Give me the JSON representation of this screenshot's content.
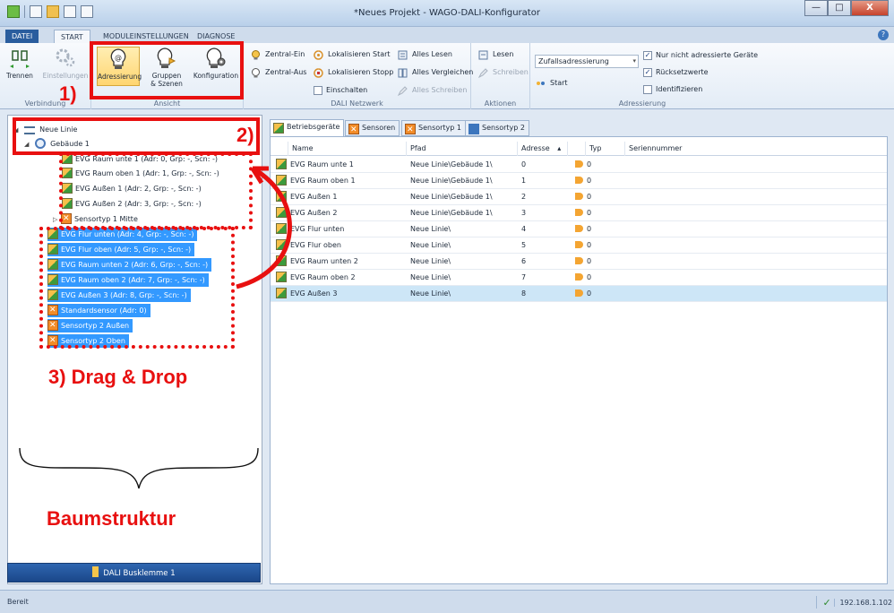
{
  "window": {
    "title": "*Neues Projekt - WAGO-DALI-Konfigurator",
    "minimize": "—",
    "maximize": "□",
    "close": "X"
  },
  "ribbon_tabs": [
    {
      "label": "DATEI",
      "active": false
    },
    {
      "label": "START",
      "active": true
    },
    {
      "label": "MODULEINSTELLUNGEN",
      "active": false
    },
    {
      "label": "DIAGNOSE",
      "active": false
    }
  ],
  "help": "?",
  "ribbon": {
    "verbindung": {
      "label": "Verbindung",
      "trennen": "Trennen",
      "einstellungen": "Einstellungen"
    },
    "ansicht": {
      "label": "Ansicht",
      "adressierung": "Adressierung",
      "gruppen_szenen_1": "Gruppen",
      "gruppen_szenen_2": "& Szenen",
      "konfiguration": "Konfiguration"
    },
    "dali_netzwerk": {
      "label": "DALI Netzwerk",
      "zentral_ein": "Zentral-Ein",
      "zentral_aus": "Zentral-Aus",
      "lokalisieren_start": "Lokalisieren Start",
      "lokalisieren_stopp": "Lokalisieren Stopp",
      "einschalten": "Einschalten",
      "alles_lesen": "Alles Lesen",
      "alles_vergleichen": "Alles Vergleichen",
      "alles_schreiben": "Alles Schreiben"
    },
    "aktionen": {
      "label": "Aktionen",
      "lesen": "Lesen",
      "schreiben": "Schreiben"
    },
    "adressierung": {
      "label": "Adressierung",
      "combo_value": "Zufallsadressierung",
      "start": "Start",
      "nur_nicht_adressierte": "Nur nicht adressierte Geräte",
      "ruecksetzwerte": "Rücksetzwerte",
      "identifizieren": "Identifizieren",
      "nur_nicht_adressierte_checked": "✓",
      "ruecksetzwerte_checked": "✓"
    }
  },
  "tree": {
    "root": "Neue Linie",
    "building": "Gebäude 1",
    "building_children": [
      "EVG Raum unte 1 (Adr: 0, Grp: -, Scn: -)",
      "EVG Raum oben 1 (Adr: 1, Grp: -, Scn: -)",
      "EVG Außen 1 (Adr: 2, Grp: -, Scn: -)",
      "EVG Außen 2 (Adr: 3, Grp: -, Scn: -)",
      "Sensortyp 1 Mitte"
    ],
    "line_children": [
      "EVG Flur unten (Adr: 4, Grp: -, Scn: -)",
      "EVG Flur oben (Adr: 5, Grp: -, Scn: -)",
      "EVG Raum unten 2 (Adr: 6, Grp: -, Scn: -)",
      "EVG Raum oben 2 (Adr: 7, Grp: -, Scn: -)",
      "EVG Außen 3 (Adr: 8, Grp: -, Scn: -)",
      "Standardsensor  (Adr: 0)",
      "Sensortyp 2 Außen",
      "Sensortyp 2 Oben"
    ],
    "bus_button": "DALI Busklemme 1"
  },
  "grid_tabs": [
    "Betriebsgeräte",
    "Sensoren",
    "Sensortyp 1",
    "Sensortyp 2"
  ],
  "grid": {
    "headers": {
      "name": "Name",
      "pfad": "Pfad",
      "adresse": "Adresse",
      "sort_icon": "▴",
      "typ": "Typ",
      "seriennummer": "Seriennummer"
    },
    "rows": [
      {
        "name": "EVG Raum unte 1",
        "pfad": "Neue Linie\\Gebäude 1\\",
        "adresse": "0",
        "typ": "0"
      },
      {
        "name": "EVG Raum oben 1",
        "pfad": "Neue Linie\\Gebäude 1\\",
        "adresse": "1",
        "typ": "0"
      },
      {
        "name": "EVG Außen 1",
        "pfad": "Neue Linie\\Gebäude 1\\",
        "adresse": "2",
        "typ": "0"
      },
      {
        "name": "EVG Außen 2",
        "pfad": "Neue Linie\\Gebäude 1\\",
        "adresse": "3",
        "typ": "0"
      },
      {
        "name": "EVG Flur unten",
        "pfad": "Neue Linie\\",
        "adresse": "4",
        "typ": "0"
      },
      {
        "name": "EVG Flur oben",
        "pfad": "Neue Linie\\",
        "adresse": "5",
        "typ": "0"
      },
      {
        "name": "EVG Raum unten 2",
        "pfad": "Neue Linie\\",
        "adresse": "6",
        "typ": "0"
      },
      {
        "name": "EVG Raum oben 2",
        "pfad": "Neue Linie\\",
        "adresse": "7",
        "typ": "0"
      },
      {
        "name": "EVG Außen 3",
        "pfad": "Neue Linie\\",
        "adresse": "8",
        "typ": "0"
      }
    ]
  },
  "status": {
    "text": "Bereit",
    "ip": "192.168.1.102"
  },
  "annotations": {
    "label_1": "1)",
    "label_2": "2)",
    "label_3": "3) Drag & Drop",
    "label_tree": "Baumstruktur",
    "color": "#e81010"
  },
  "colors": {
    "selection": "#3399ff",
    "selected_row": "#cde6f7",
    "file_tab": "#2a5d9e",
    "accent_red": "#e81010"
  }
}
